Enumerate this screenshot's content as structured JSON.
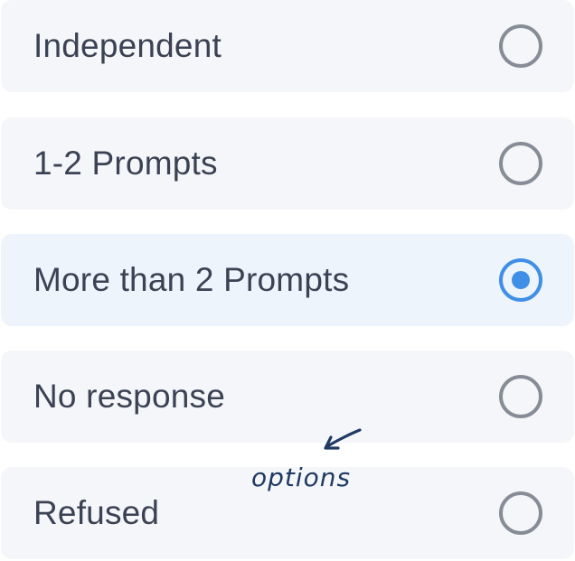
{
  "options": [
    {
      "label": "Independent",
      "selected": false
    },
    {
      "label": "1-2 Prompts",
      "selected": false
    },
    {
      "label": "More than 2 Prompts",
      "selected": true
    },
    {
      "label": "No response",
      "selected": false
    },
    {
      "label": "Refused",
      "selected": false
    }
  ],
  "annotation": {
    "text": "options"
  },
  "colors": {
    "row_background": "#f5f6f9",
    "selected_row_background": "#eef4fc",
    "label_text": "#3b4253",
    "radio_unchecked": "#878d96",
    "radio_checked": "#3f8fe6",
    "annotation_ink": "#1f3a63"
  },
  "icons": {
    "radio_unchecked": "radio-unchecked-icon",
    "radio_checked": "radio-checked-icon",
    "annotation_arrow": "arrow-icon"
  }
}
